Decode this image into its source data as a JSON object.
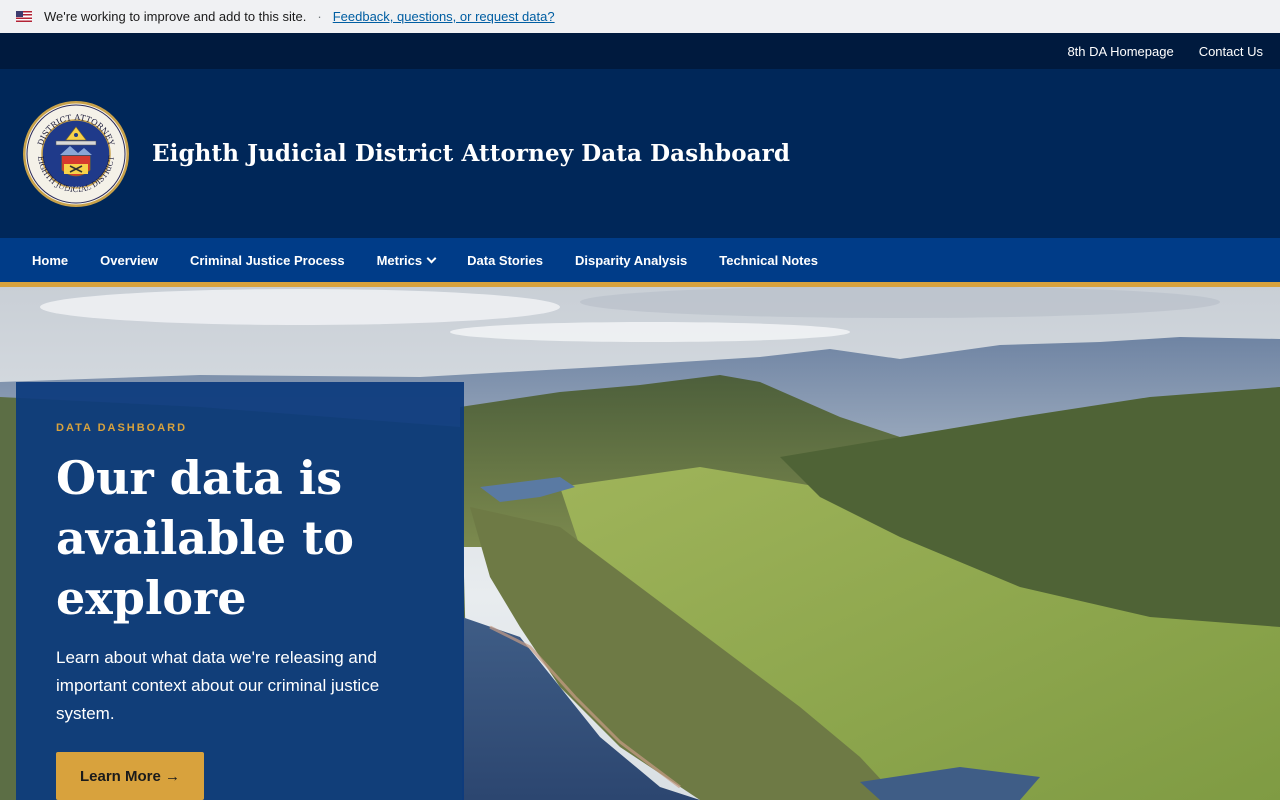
{
  "banner": {
    "text": "We're working to improve and add to this site.",
    "separator": "·",
    "link": "Feedback, questions, or request data?"
  },
  "utility": {
    "links": [
      "8th DA Homepage",
      "Contact Us"
    ]
  },
  "header": {
    "title": "Eighth Judicial District Attorney Data Dashboard",
    "seal_text": [
      "DISTRICT ATTORNEY",
      "EIGHTH JUDICIAL DISTRICT",
      "STATE OF COLORADO"
    ]
  },
  "nav": {
    "items": [
      "Home",
      "Overview",
      "Criminal Justice Process",
      "Metrics",
      "Data Stories",
      "Disparity Analysis",
      "Technical Notes"
    ]
  },
  "hero": {
    "eyebrow": "DATA DASHBOARD",
    "title": "Our data is available to explore",
    "text": "Learn about what data we're releasing and important context about our criminal justice system.",
    "cta": "Learn More →"
  },
  "colors": {
    "header_bg": "#002759",
    "utility_bg": "#001a3e",
    "nav_bg": "#003c88",
    "accent_gold": "#d8a23d",
    "card_bg": "#0c3a7d"
  }
}
